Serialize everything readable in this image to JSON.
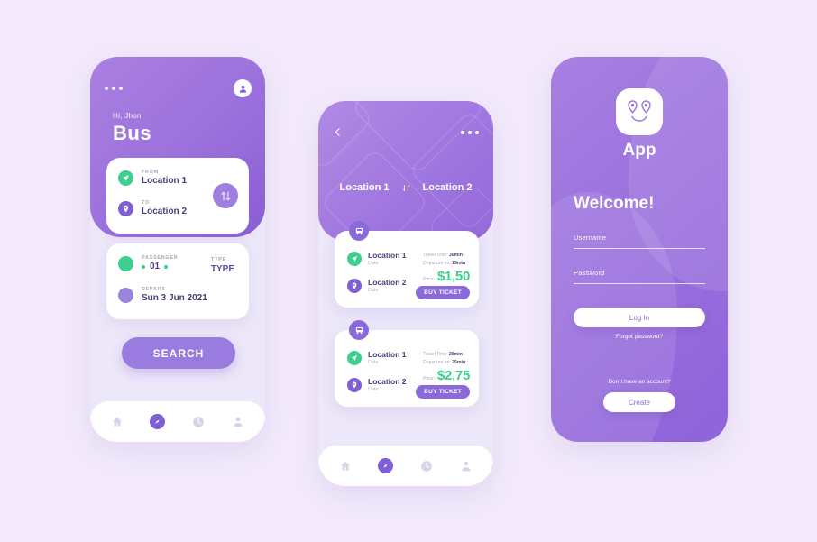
{
  "theme": {
    "background": "#f2eafb",
    "purple_primary": "#8a6ad8",
    "purple_light": "#a97fe0",
    "green_accent": "#3ecf8e",
    "text_dark": "#4a3f75",
    "text_muted": "#a9a6b8"
  },
  "screen_search": {
    "menu_icon": "three-dots-icon",
    "avatar_icon": "user-avatar-icon",
    "greeting": "Hi, Jhon",
    "title": "Bus",
    "route_card": {
      "from_label": "FROM",
      "from_value": "Location 1",
      "from_icon": "navigation-arrow-icon",
      "to_label": "TO",
      "to_value": "Location 2",
      "to_icon": "map-pin-icon",
      "swap_icon": "swap-up-down-icon"
    },
    "detail_card": {
      "passenger_label": "PASSENGER",
      "passenger_value": "01",
      "type_label": "TYPE",
      "type_value": "TYPE",
      "depart_label": "DEPART",
      "depart_value": "Sun 3 Jun 2021",
      "decrement_icon": "minus-dot-icon",
      "increment_icon": "plus-dot-icon"
    },
    "search_button": "SEARCH",
    "navbar": [
      {
        "icon": "home-icon",
        "active": false
      },
      {
        "icon": "compass-icon",
        "active": true
      },
      {
        "icon": "clock-icon",
        "active": false
      },
      {
        "icon": "person-icon",
        "active": false
      }
    ]
  },
  "screen_results": {
    "back_icon": "chevron-left-icon",
    "menu_icon": "three-dots-icon",
    "origin": "Location 1",
    "destination": "Location 2",
    "swap_icon": "transfer-arrows-icon",
    "tickets": [
      {
        "badge_icon": "bus-icon",
        "from_name": "Location 1",
        "from_sub": "Date",
        "to_name": "Location 2",
        "to_sub": "Date",
        "travel_time_label": "Travel Time:",
        "travel_time_value": "30min",
        "departure_label": "Departure on:",
        "departure_value": "15min",
        "price_label": "Price:",
        "price_value": "$1,50",
        "buy_label": "BUY TICKET"
      },
      {
        "badge_icon": "bus-icon",
        "from_name": "Location 1",
        "from_sub": "Date",
        "to_name": "Location 2",
        "to_sub": "Date",
        "travel_time_label": "Travel Time:",
        "travel_time_value": "20min",
        "departure_label": "Departure on:",
        "departure_value": "25min",
        "price_label": "Price:",
        "price_value": "$2,75",
        "buy_label": "BUY TICKET"
      }
    ],
    "navbar": [
      {
        "icon": "home-icon",
        "active": false
      },
      {
        "icon": "compass-icon",
        "active": true
      },
      {
        "icon": "clock-icon",
        "active": false
      },
      {
        "icon": "person-icon",
        "active": false
      }
    ]
  },
  "screen_login": {
    "logo_icon": "smiley-pins-logo-icon",
    "app_name": "App",
    "welcome": "Welcome!",
    "username_label": "Username",
    "password_label": "Password",
    "login_button": "Log In",
    "forgot_password": "Forgot password?",
    "no_account": "Don´t have an account?",
    "create_button": "Create"
  }
}
